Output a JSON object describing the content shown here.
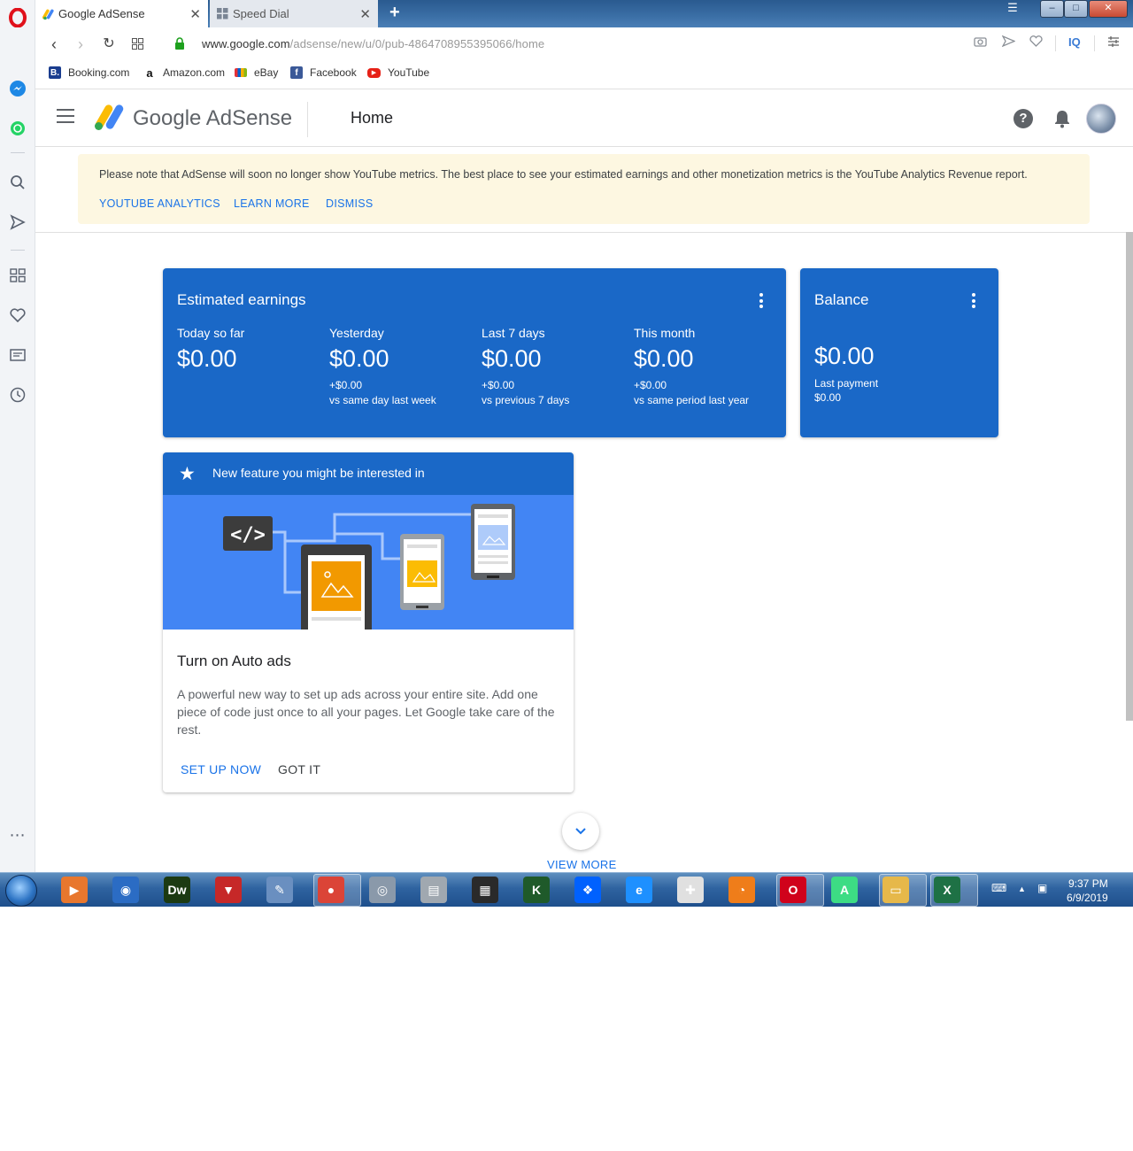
{
  "browser": {
    "tabs": [
      {
        "label": "Google AdSense",
        "close": "✕"
      },
      {
        "label": "Speed Dial",
        "close": "✕"
      }
    ],
    "new_tab": "+",
    "window_controls": [
      "–",
      "□",
      "✕"
    ],
    "url_host": "www.google.com",
    "url_path": "/adsense/new/u/0/pub-4864708955395066/home",
    "iq_label": "IQ",
    "bookmarks": [
      {
        "label": "Booking.com",
        "icon": "B.",
        "color": "#1a3d8f"
      },
      {
        "label": "Amazon.com",
        "icon": "a",
        "color": "#111111"
      },
      {
        "label": "eBay",
        "icon": "",
        "color": "#e53238"
      },
      {
        "label": "Facebook",
        "icon": "f",
        "color": "#3b5998"
      },
      {
        "label": "YouTube",
        "icon": "▶",
        "color": "#e62117"
      }
    ]
  },
  "adsense": {
    "brand": "Google AdSense",
    "page_title": "Home",
    "help_icon": "?",
    "notice": {
      "text": "Please note that AdSense will soon no longer show YouTube metrics. The best place to see your estimated earnings and other monetization metrics is the YouTube Analytics Revenue report.",
      "links": [
        "YOUTUBE ANALYTICS",
        "LEARN MORE",
        "DISMISS"
      ]
    },
    "earnings": {
      "title": "Estimated earnings",
      "metrics": [
        {
          "label": "Today so far",
          "value": "$0.00",
          "delta": "",
          "compare": ""
        },
        {
          "label": "Yesterday",
          "value": "$0.00",
          "delta": "+$0.00",
          "compare": "vs same day last week"
        },
        {
          "label": "Last 7 days",
          "value": "$0.00",
          "delta": "+$0.00",
          "compare": "vs previous 7 days"
        },
        {
          "label": "This month",
          "value": "$0.00",
          "delta": "+$0.00",
          "compare": "vs same period last year"
        }
      ]
    },
    "balance": {
      "title": "Balance",
      "value": "$0.00",
      "last_payment_label": "Last payment",
      "last_payment_value": "$0.00"
    },
    "feature": {
      "header": "New feature you might be interested in",
      "code_badge": "</>",
      "title": "Turn on Auto ads",
      "body": "A powerful new way to set up ads across your entire site. Add one piece of code just once to all your pages. Let Google take care of the rest.",
      "primary": "SET UP NOW",
      "secondary": "GOT IT"
    },
    "view_more": "VIEW MORE"
  },
  "taskbar": {
    "time": "9:37 PM",
    "date": "6/9/2019",
    "apps": [
      {
        "name": "media-player-icon",
        "glyph": "▶",
        "color": "#e8772e"
      },
      {
        "name": "maxthon-icon",
        "glyph": "◉",
        "color": "#2b6cc4"
      },
      {
        "name": "dreamweaver-icon",
        "glyph": "Dw",
        "color": "#1c3a12"
      },
      {
        "name": "tv-downloader-icon",
        "glyph": "▼",
        "color": "#c62828"
      },
      {
        "name": "paint-icon",
        "glyph": "✎",
        "color": "#6a8fc0"
      },
      {
        "name": "chrome-icon",
        "glyph": "●",
        "color": "#db4437"
      },
      {
        "name": "scanner-icon",
        "glyph": "◎",
        "color": "#8a99aa"
      },
      {
        "name": "server-icon",
        "glyph": "▤",
        "color": "#a0a8b0"
      },
      {
        "name": "app-grid-icon",
        "glyph": "▦",
        "color": "#2a2a2a"
      },
      {
        "name": "k-app-icon",
        "glyph": "K",
        "color": "#1f5a2a"
      },
      {
        "name": "dropbox-icon",
        "glyph": "❖",
        "color": "#0061fe"
      },
      {
        "name": "ie-icon",
        "glyph": "e",
        "color": "#1e90ff"
      },
      {
        "name": "gamepad-icon",
        "glyph": "✚",
        "color": "#e0e0e0"
      },
      {
        "name": "vpn-icon",
        "glyph": "◔",
        "color": "#ef7d1a"
      },
      {
        "name": "opera-task-icon",
        "glyph": "O",
        "color": "#d0021b"
      },
      {
        "name": "android-studio-icon",
        "glyph": "A",
        "color": "#3ddc84"
      },
      {
        "name": "explorer-icon",
        "glyph": "▭",
        "color": "#e6b84a"
      },
      {
        "name": "excel-icon",
        "glyph": "X",
        "color": "#1e7145"
      }
    ]
  }
}
